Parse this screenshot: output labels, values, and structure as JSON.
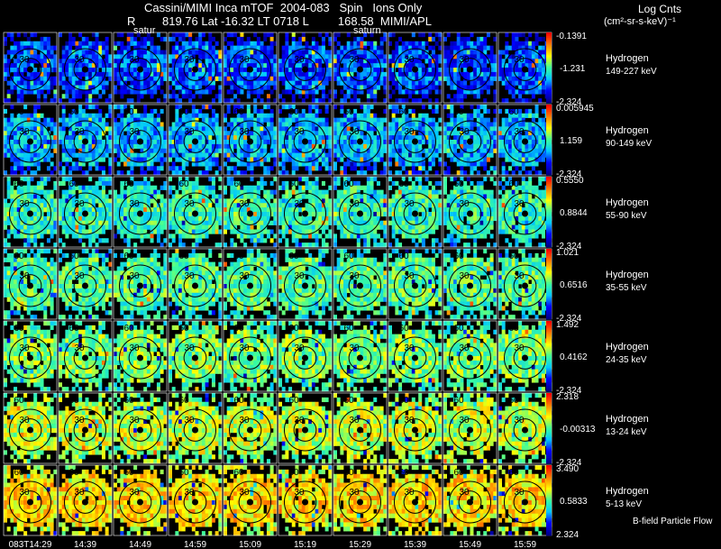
{
  "header": {
    "title": "Cassini/MIMI Inca mTOF  2004-083   Spin   Ions Only",
    "ephem_r": "R",
    "ephem": "819.76 Lat -16.32 LT 0718 L         168.58  MIMI/APL",
    "units_title": "Log Cnts",
    "units_sub": "(cm²-sr-s-keV)⁻¹"
  },
  "footer_note": "B-field Particle Flow",
  "chart_data": {
    "type": "heatmap",
    "title": "Cassini/MIMI Inca mTOF  2004-083   Spin   Ions Only",
    "colormap": [
      "#00008b",
      "#0000ff",
      "#00c8ff",
      "#3cff9c",
      "#ffff00",
      "#ff8000",
      "#ff0000"
    ],
    "time_labels": [
      "083T14:29",
      "14:39",
      "14:49",
      "14:59",
      "15:09",
      "15:19",
      "15:29",
      "15:39",
      "15:49",
      "15:59"
    ],
    "column_annotations": [
      {
        "column": 2,
        "text": "satur"
      },
      {
        "column": 6,
        "text": "saturn"
      }
    ],
    "rows": [
      {
        "species": "Hydrogen",
        "energy": "149-227 keV",
        "scale": [
          "-0.1391",
          "-1.231",
          "-2.324"
        ],
        "level": 0.22,
        "ring_labels": [
          "30"
        ]
      },
      {
        "species": "Hydrogen",
        "energy": "90-149 keV",
        "scale": [
          "0.005945",
          "1.159",
          "-2.324"
        ],
        "level": 0.33,
        "ring_labels": [
          "60",
          "30"
        ]
      },
      {
        "species": "Hydrogen",
        "energy": "55-90 keV",
        "scale": [
          "0.5550",
          "0.8844",
          "-2.324"
        ],
        "level": 0.46,
        "ring_labels": [
          "60",
          "30"
        ]
      },
      {
        "species": "Hydrogen",
        "energy": "35-55 keV",
        "scale": [
          "1.021",
          "0.6516",
          "-2.324"
        ],
        "level": 0.5,
        "ring_labels": [
          "60",
          "30"
        ]
      },
      {
        "species": "Hydrogen",
        "energy": "24-35 keV",
        "scale": [
          "1.492",
          "0.4162",
          "-2.324"
        ],
        "level": 0.55,
        "ring_labels": [
          "60",
          "30"
        ]
      },
      {
        "species": "Hydrogen",
        "energy": "13-24 keV",
        "scale": [
          "2.318",
          "-0.00313",
          "-2.324"
        ],
        "level": 0.62,
        "ring_labels": [
          "60",
          "30"
        ]
      },
      {
        "species": "Hydrogen",
        "energy": "5-13 keV",
        "scale": [
          "3.490",
          "0.5833",
          "2.324"
        ],
        "level": 0.72,
        "ring_labels": [
          "60",
          "30"
        ]
      }
    ]
  }
}
